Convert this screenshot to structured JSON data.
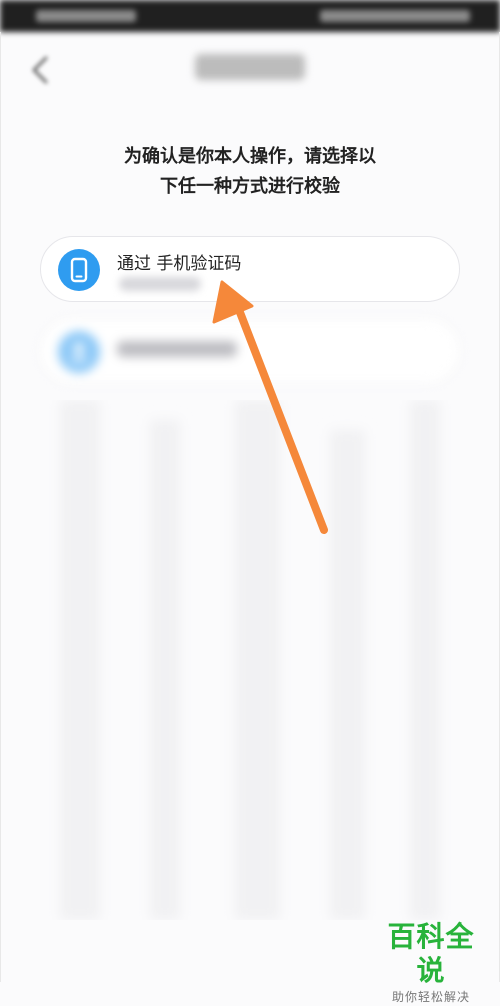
{
  "instruction": {
    "line1": "为确认是你本人操作，请选择以",
    "line2": "下任一种方式进行校验"
  },
  "options": [
    {
      "label": "通过 手机验证码",
      "icon": "phone-icon"
    },
    {
      "label": "",
      "icon": "user-icon"
    }
  ],
  "colors": {
    "accent": "#2f9cf0",
    "arrow": "#f5883a",
    "watermark": "#28b33b"
  },
  "watermark": {
    "title": "百科全说",
    "subtitle": "助你轻松解决"
  }
}
